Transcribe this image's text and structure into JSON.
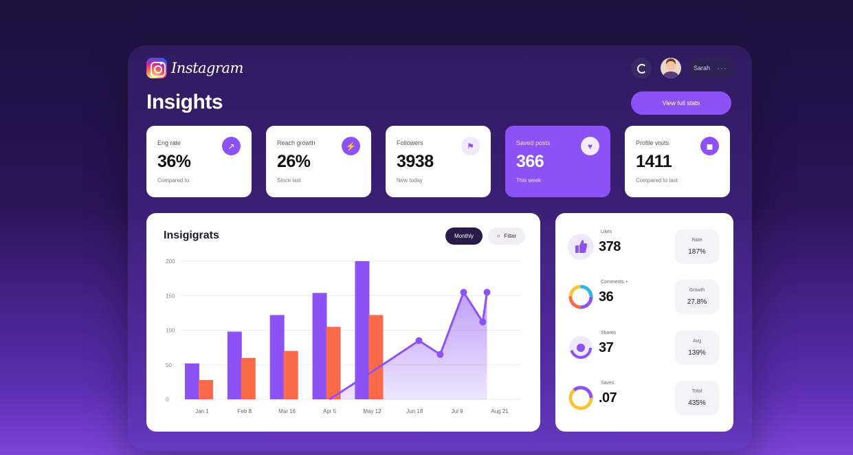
{
  "brand": {
    "name": "Instagram"
  },
  "header": {
    "title": "Insights",
    "user_label": "Sarah",
    "more_label": "···",
    "cta_label": "View full stats"
  },
  "stats": [
    {
      "label": "Eng rate",
      "value": "36%",
      "sub": "Compared to",
      "icon": "chart-icon",
      "glyph": "↗"
    },
    {
      "label": "Reach growth",
      "value": "26%",
      "sub": "Since last",
      "icon": "bolt-icon",
      "glyph": "⚡"
    },
    {
      "label": "Followers",
      "value": "3938",
      "sub": "New today",
      "icon": "flag-icon",
      "glyph": "⚑"
    },
    {
      "label": "Saved posts",
      "value": "366",
      "sub": "This week",
      "icon": "heart-icon",
      "glyph": "♥"
    },
    {
      "label": "Profile visits",
      "value": "1411",
      "sub": "Compared to last",
      "icon": "user-icon",
      "glyph": "◼"
    }
  ],
  "chart": {
    "title": "Insigigrats",
    "filter_primary": "Monthly",
    "filter_secondary": "Filter"
  },
  "chart_data": {
    "type": "bar",
    "categories": [
      "Jan 1",
      "Feb 8",
      "Mar 16",
      "Apr 5",
      "May 12",
      "Jun 18",
      "Jul 9",
      "Aug 21"
    ],
    "ylim": [
      0,
      200
    ],
    "yticks": [
      "0",
      "50",
      "100",
      "150",
      "200"
    ],
    "series": [
      {
        "type": "bar",
        "values": [
          52,
          98,
          122,
          154,
          200
        ],
        "color": "#8c52f6"
      },
      {
        "type": "bar",
        "values": [
          28,
          60,
          70,
          105,
          122
        ],
        "color": "#fb6a4a"
      }
    ],
    "line": {
      "type": "area",
      "color": "#8c52f6",
      "points": [
        [
          3.0,
          0
        ],
        [
          4.0,
          40
        ],
        [
          5.1,
          85
        ],
        [
          5.6,
          65
        ],
        [
          6.15,
          155
        ],
        [
          6.6,
          112
        ],
        [
          6.7,
          155
        ]
      ]
    }
  },
  "engagement_list": [
    {
      "label": "Likes",
      "value": "378",
      "pill_label": "Rate",
      "pill_value": "187%",
      "icon": "thumbs-up-icon"
    },
    {
      "label": "Comments +",
      "value": "36",
      "pill_label": "Growth",
      "pill_value": "27.8%",
      "icon": "ring-chart-icon"
    },
    {
      "label": "Shares",
      "value": "37",
      "pill_label": "Avg",
      "pill_value": "139%",
      "icon": "target-icon"
    },
    {
      "label": "Saves",
      "value": ".07",
      "pill_label": "Total",
      "pill_value": "435%",
      "icon": "donut-icon"
    }
  ]
}
